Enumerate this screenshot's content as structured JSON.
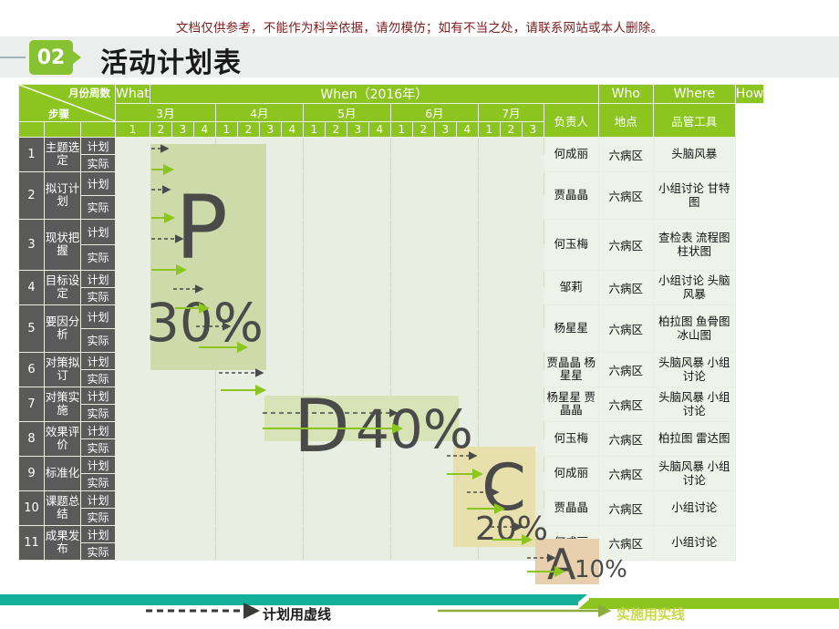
{
  "watermark": "文档仅供参考，不能作为科学依据，请勿模仿；如有不当之处，请联系网站或本人删除。",
  "header": {
    "badge": "02",
    "title": "活动计划表"
  },
  "table": {
    "group_headers": {
      "what": "What",
      "when": "When（2016年）",
      "who": "Who",
      "where": "Where",
      "how": "How"
    },
    "corner": {
      "top": "月份周数",
      "bottom": "步骤"
    },
    "sub_headers": {
      "who": "负责人",
      "where": "地点",
      "how": "品管工具"
    },
    "months": [
      {
        "label": "3月",
        "weeks": [
          "1",
          "2",
          "3",
          "4"
        ]
      },
      {
        "label": "4月",
        "weeks": [
          "1",
          "2",
          "3",
          "4"
        ]
      },
      {
        "label": "5月",
        "weeks": [
          "1",
          "2",
          "3",
          "4"
        ]
      },
      {
        "label": "6月",
        "weeks": [
          "1",
          "2",
          "3",
          "4"
        ]
      },
      {
        "label": "7月",
        "weeks": [
          "1",
          "2",
          "3"
        ]
      }
    ],
    "plan_label": "计划",
    "actual_label": "实际",
    "rows": [
      {
        "no": "1",
        "step": "主题选定",
        "who": "何成丽",
        "where": "六病区",
        "how": "头脑风暴"
      },
      {
        "no": "2",
        "step": "拟订计划",
        "who": "贾晶晶",
        "where": "六病区",
        "how": "小组讨论 甘特图"
      },
      {
        "no": "3",
        "step": "现状把握",
        "who": "何玉梅",
        "where": "六病区",
        "how": "查检表 流程图柱状图"
      },
      {
        "no": "4",
        "step": "目标设定",
        "who": "邹莉",
        "where": "六病区",
        "how": "小组讨论 头脑风暴"
      },
      {
        "no": "5",
        "step": "要因分析",
        "who": "杨星星",
        "where": "六病区",
        "how": "柏拉图 鱼骨图 冰山图"
      },
      {
        "no": "6",
        "step": "对策拟订",
        "who": "贾晶晶 杨星星",
        "where": "六病区",
        "how": "头脑风暴 小组讨论"
      },
      {
        "no": "7",
        "step": "对策实施",
        "who": "杨星星 贾晶晶",
        "where": "六病区",
        "how": "头脑风暴 小组讨论"
      },
      {
        "no": "8",
        "step": "效果评价",
        "who": "何玉梅",
        "where": "六病区",
        "how": "柏拉图 雷达图"
      },
      {
        "no": "9",
        "step": "标准化",
        "who": "何成丽",
        "where": "六病区",
        "how": "头脑风暴 小组讨论"
      },
      {
        "no": "10",
        "step": "课题总结",
        "who": "贾晶晶",
        "where": "六病区",
        "how": "小组讨论"
      },
      {
        "no": "11",
        "step": "成果发布",
        "who": "何成丽",
        "where": "六病区",
        "how": "小组讨论"
      }
    ]
  },
  "pdca": {
    "p": {
      "letter": "P",
      "percent": "30%"
    },
    "d": {
      "letter": "D",
      "percent": "40%"
    },
    "c": {
      "letter": "C",
      "percent": "20%"
    },
    "a": {
      "letter": "A",
      "percent": "10%"
    }
  },
  "legend": {
    "dashed": "计划用虚线",
    "solid": "实施用实线"
  },
  "colors": {
    "header_green": "#8cc51f",
    "dark_cell": "#5a5a5a",
    "zone_p": "#cedaa9",
    "zone_d": "#d8e4b8",
    "zone_c": "#e8e0ac",
    "zone_a": "#e8cfae",
    "teal": "#15b09a",
    "plan_arrow": "#4a4a48",
    "actual_arrow": "#8cc51f"
  }
}
